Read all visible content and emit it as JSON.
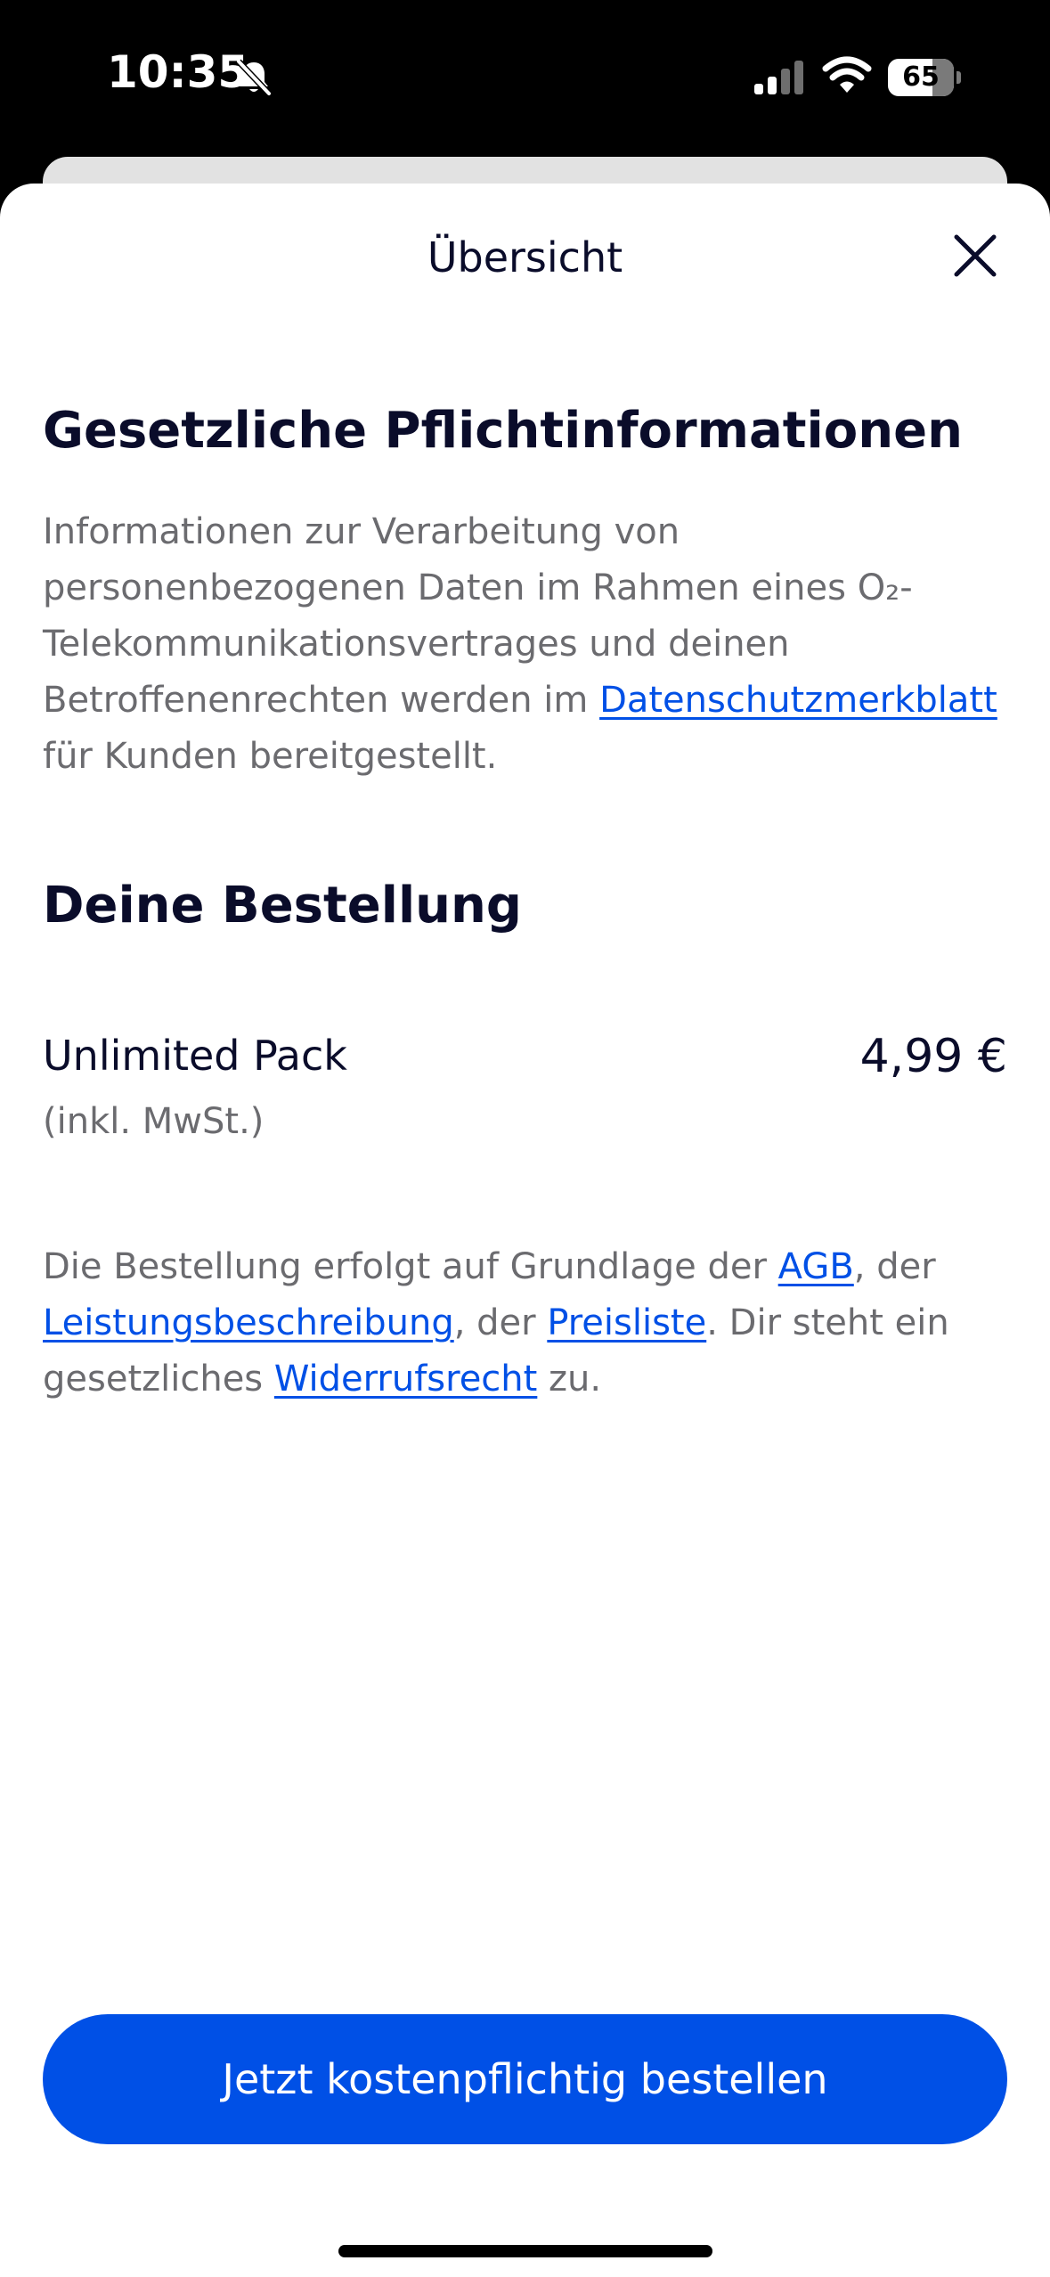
{
  "status_bar": {
    "time": "10:35",
    "battery": "65",
    "icons": [
      "bell-slash-icon",
      "cellular-signal-icon",
      "wifi-icon",
      "battery-icon"
    ]
  },
  "header": {
    "title": "Übersicht",
    "close_icon": "close-icon"
  },
  "legal": {
    "heading": "Gesetzliche Pflichtinformationen",
    "text_before_link": "Informationen zur Verarbeitung von personenbezogenen Daten im Rahmen eines O₂-Telekommunikationsvertrages und deinen Betroffenenrechten werden im ",
    "link": "Datenschutzmerkblatt",
    "text_after_link": " für Kunden bereitgestellt."
  },
  "order": {
    "heading": "Deine Bestellung",
    "item_name": "Unlimited Pack",
    "item_price": "4,99 €",
    "item_tax_note": "(inkl. MwSt.)"
  },
  "terms": {
    "t1": "Die Bestellung erfolgt auf Grundlage der ",
    "link_agb": "AGB",
    "t2": ", der ",
    "link_leistung": "Leistungsbeschreibung",
    "t3": ", der ",
    "link_preisliste": "Preisliste",
    "t4": ". Dir steht ein gesetzliches ",
    "link_widerruf": "Widerrufsrecht",
    "t5": " zu."
  },
  "cta": {
    "label": "Jetzt kostenpflichtig bestellen"
  },
  "colors": {
    "accent": "#0050e6",
    "text_primary": "#0a0c2a",
    "text_secondary": "#6b6b6f"
  }
}
